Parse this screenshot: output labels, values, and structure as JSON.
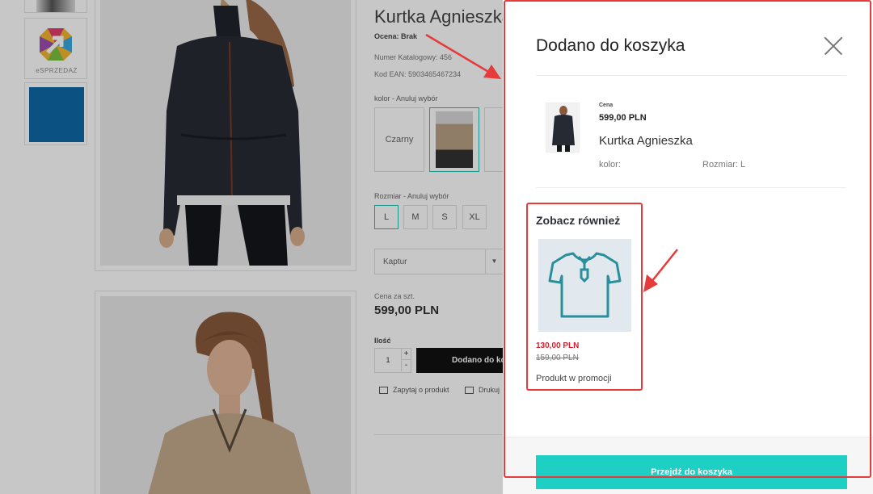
{
  "product_page": {
    "thumbnail_brand_text": "eSPRZEDAŻ",
    "title": "Kurtka Agnieszka",
    "rating": "Ocena: Brak",
    "catalog_number": "Numer Katalogowy: 456",
    "ean": "Kod EAN: 5903465467234",
    "color_label": "kolor - Anuluj wybór",
    "color_swatches": [
      "Czarny"
    ],
    "size_label": "Rozmiar - Anuluj wybór",
    "sizes": [
      "L",
      "M",
      "S",
      "XL"
    ],
    "selected_size": "L",
    "option_select": "Kaptur",
    "unit_price_label": "Cena za szt.",
    "unit_price": "599,00 PLN",
    "quantity_label": "Ilość",
    "quantity": "1",
    "add_button": "Dodano do koszyka",
    "ask_link": "Zapytaj o produkt",
    "print_link": "Drukuj"
  },
  "cart_drawer": {
    "title": "Dodano do koszyka",
    "item": {
      "price_label": "Cena",
      "price": "599,00 PLN",
      "name": "Kurtka Agnieszka",
      "color_attr": "kolor:",
      "size_attr": "Rozmiar: L"
    },
    "see_also": {
      "title": "Zobacz również",
      "product": {
        "price": "130,00 PLN",
        "old_price": "159,00 PLN",
        "name": "Produkt w promocji",
        "icon": "tshirt-icon"
      }
    },
    "checkout_button": "Przejdź do koszyka"
  },
  "colors": {
    "accent": "#1ecfc3",
    "promo_price": "#d31f2b",
    "annotation": "#e53b3b"
  }
}
